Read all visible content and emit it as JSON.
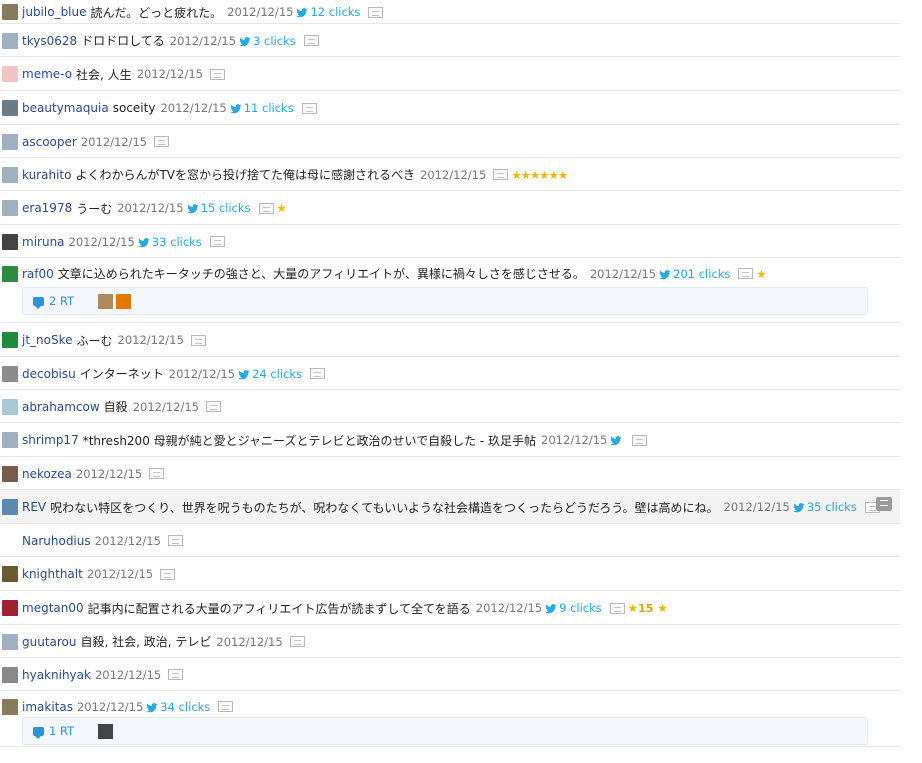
{
  "entries": [
    {
      "user": "jubilo_blue",
      "comment": "読んだ。どっと疲れた。",
      "date": "2012/12/15",
      "clicks": "12 clicks",
      "avatar": "#8a7a5c"
    },
    {
      "user": "tkys0628",
      "comment": "ドロドロしてる",
      "date": "2012/12/15",
      "clicks": "3 clicks",
      "avatar": "#9fb0c0"
    },
    {
      "user": "meme-o",
      "comment": "社会, 人生",
      "date": "2012/12/15",
      "clicks": "",
      "avatar": "#f2c4c4"
    },
    {
      "user": "beautymaquia",
      "comment": "soceity",
      "date": "2012/12/15",
      "clicks": "11 clicks",
      "avatar": "#6d7a88"
    },
    {
      "user": "ascooper",
      "comment": "",
      "date": "2012/12/15",
      "clicks": "",
      "avatar": "#9fb0c0"
    },
    {
      "user": "kurahito",
      "comment": "よくわからんがTVを窓から投げ捨てた俺は母に感謝されるべき",
      "date": "2012/12/15",
      "clicks": "",
      "stars": "★★★★★★",
      "avatar": "#9fb0c0"
    },
    {
      "user": "era1978",
      "comment": "うーむ",
      "date": "2012/12/15",
      "clicks": "15 clicks",
      "stars": "★",
      "avatar": "#9fb0c0"
    },
    {
      "user": "miruna",
      "comment": "",
      "date": "2012/12/15",
      "clicks": "33 clicks",
      "avatar": "#444444"
    },
    {
      "user": "raf00",
      "comment": "文章に込められたキータッチの強さと、大量のアフィリエイトが、異様に禍々しさを感じさせる。",
      "date": "2012/12/15",
      "clicks": "201 clicks",
      "stars": "★",
      "avatar": "#2e8b3e",
      "rt": {
        "label": "2 RT",
        "avatars": [
          "#b08860",
          "#e07a00"
        ]
      }
    },
    {
      "user": "jt_noSke",
      "comment": "ふーむ",
      "date": "2012/12/15",
      "clicks": "",
      "avatar": "#1f8a3a"
    },
    {
      "user": "decobisu",
      "comment": "インターネット",
      "date": "2012/12/15",
      "clicks": "24 clicks",
      "avatar": "#8c8c8c"
    },
    {
      "user": "abrahamcow",
      "comment": "自殺",
      "date": "2012/12/15",
      "clicks": "",
      "avatar": "#a8c8d8"
    },
    {
      "user": "shrimp17",
      "comment": "*thresh200 母親が純と愛とジャニーズとテレビと政治のせいで自殺した - 玖足手帖",
      "date": "2012/12/15",
      "clicks": " ",
      "avatar": "#9fb0c0"
    },
    {
      "user": "nekozea",
      "comment": "",
      "date": "2012/12/15",
      "clicks": "",
      "avatar": "#7a5a48"
    },
    {
      "user": "REV",
      "comment": "呪わない特区をつくり、世界を呪うものたちが、呪わなくてもいいような社会構造をつくったらどうだろう。壁は高めにね。",
      "date": "2012/12/15",
      "clicks": "35 clicks",
      "stars": "★",
      "avatar": "#5a8ab0",
      "highlight": true
    },
    {
      "user": "Naruhodius",
      "comment": "",
      "date": "2012/12/15",
      "clicks": "",
      "avatar": ""
    },
    {
      "user": "knighthalt",
      "comment": "",
      "date": "2012/12/15",
      "clicks": "",
      "avatar": "#6a5a30"
    },
    {
      "user": "megtan00",
      "comment": "記事内に配置される大量のアフィリエイト広告が読まずして全てを語る",
      "date": "2012/12/15",
      "clicks": "9 clicks",
      "stars": "★",
      "star_count": "15",
      "stars_after": "★",
      "avatar": "#a02030"
    },
    {
      "user": "guutarou",
      "comment": "自殺, 社会, 政治, テレビ",
      "date": "2012/12/15",
      "clicks": "",
      "avatar": "#9fb0c0"
    },
    {
      "user": "hyaknihyak",
      "comment": "",
      "date": "2012/12/15",
      "clicks": "",
      "avatar": "#888888"
    },
    {
      "user": "imakitas",
      "comment": "",
      "date": "2012/12/15",
      "clicks": "34 clicks",
      "avatar": "#8a7a5c",
      "rt": {
        "label": "1 RT",
        "avatars": [
          "#444444"
        ]
      }
    }
  ]
}
